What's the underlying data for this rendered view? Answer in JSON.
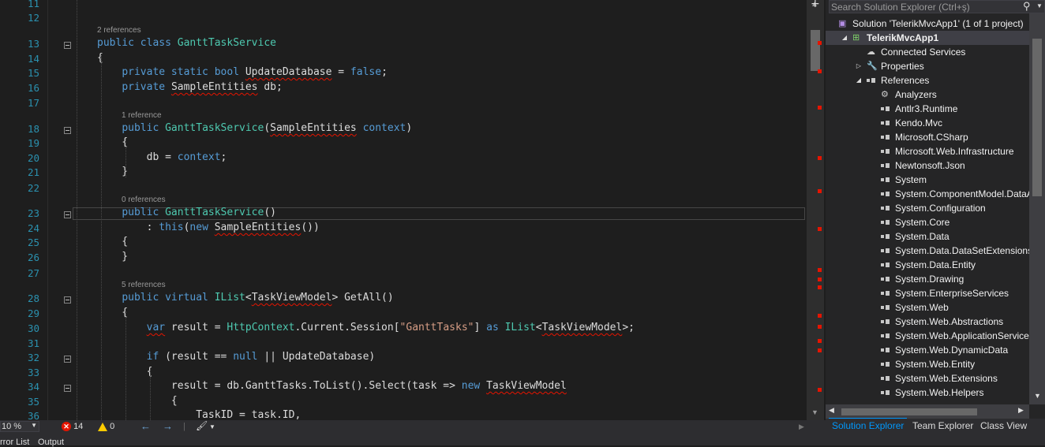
{
  "editor": {
    "lines": [
      {
        "num": "11",
        "segments": [
          {
            "t": ""
          }
        ]
      },
      {
        "num": "12",
        "segments": [
          {
            "t": ""
          }
        ]
      },
      {
        "num": "13",
        "lens": "2 references",
        "fold": true,
        "segments": [
          {
            "t": "public class ",
            "c": "kw"
          },
          {
            "t": "GanttTaskService",
            "c": "ty"
          }
        ]
      },
      {
        "num": "14",
        "segments": [
          {
            "t": "{"
          }
        ]
      },
      {
        "num": "15",
        "segments": [
          {
            "t": "    "
          },
          {
            "t": "private static bool ",
            "c": "kw"
          },
          {
            "t": "UpdateDatabase",
            "w": true
          },
          {
            "t": " = "
          },
          {
            "t": "false",
            "c": "kw"
          },
          {
            "t": ";"
          }
        ]
      },
      {
        "num": "16",
        "segments": [
          {
            "t": "    "
          },
          {
            "t": "private ",
            "c": "kw"
          },
          {
            "t": "SampleEntities",
            "w": true
          },
          {
            "t": " db;"
          }
        ]
      },
      {
        "num": "17",
        "segments": [
          {
            "t": ""
          }
        ]
      },
      {
        "num": "18",
        "lens": "1 reference",
        "fold": true,
        "segments": [
          {
            "t": "    "
          },
          {
            "t": "public ",
            "c": "kw"
          },
          {
            "t": "GanttTaskService",
            "c": "ty"
          },
          {
            "t": "("
          },
          {
            "t": "SampleEntities",
            "w": true
          },
          {
            "t": " "
          },
          {
            "t": "context",
            "c": "kw"
          },
          {
            "t": ")"
          }
        ]
      },
      {
        "num": "19",
        "segments": [
          {
            "t": "    {"
          }
        ]
      },
      {
        "num": "20",
        "segments": [
          {
            "t": "        db = "
          },
          {
            "t": "context",
            "c": "kw"
          },
          {
            "t": ";"
          }
        ]
      },
      {
        "num": "21",
        "segments": [
          {
            "t": "    }"
          }
        ]
      },
      {
        "num": "22",
        "segments": [
          {
            "t": ""
          }
        ]
      },
      {
        "num": "23",
        "lens": "0 references",
        "fold": true,
        "segments": [
          {
            "t": "    "
          },
          {
            "t": "public ",
            "c": "kw"
          },
          {
            "t": "GanttTaskService",
            "c": "ty"
          },
          {
            "t": "()"
          }
        ]
      },
      {
        "num": "24",
        "segments": [
          {
            "t": "        : "
          },
          {
            "t": "this",
            "c": "kw"
          },
          {
            "t": "("
          },
          {
            "t": "new ",
            "c": "kw"
          },
          {
            "t": "SampleEntities",
            "w": true
          },
          {
            "t": "())"
          }
        ]
      },
      {
        "num": "25",
        "segments": [
          {
            "t": "    {"
          }
        ]
      },
      {
        "num": "26",
        "segments": [
          {
            "t": "    }"
          }
        ]
      },
      {
        "num": "27",
        "segments": [
          {
            "t": ""
          }
        ]
      },
      {
        "num": "28",
        "lens": "5 references",
        "fold": true,
        "segments": [
          {
            "t": "    "
          },
          {
            "t": "public virtual ",
            "c": "kw"
          },
          {
            "t": "IList",
            "c": "ty"
          },
          {
            "t": "<"
          },
          {
            "t": "TaskViewModel",
            "w": true
          },
          {
            "t": "> GetAll()"
          }
        ]
      },
      {
        "num": "29",
        "segments": [
          {
            "t": "    {"
          }
        ]
      },
      {
        "num": "30",
        "segments": [
          {
            "t": "        "
          },
          {
            "t": "var",
            "c": "kw",
            "w": true
          },
          {
            "t": " result = "
          },
          {
            "t": "HttpContext",
            "c": "ty"
          },
          {
            "t": ".Current.Session["
          },
          {
            "t": "\"GanttTasks\"",
            "c": "st"
          },
          {
            "t": "] "
          },
          {
            "t": "as ",
            "c": "kw"
          },
          {
            "t": "IList",
            "c": "ty"
          },
          {
            "t": "<"
          },
          {
            "t": "TaskViewModel",
            "w": true
          },
          {
            "t": ">;"
          }
        ]
      },
      {
        "num": "31",
        "segments": [
          {
            "t": ""
          }
        ]
      },
      {
        "num": "32",
        "fold": true,
        "segments": [
          {
            "t": "        "
          },
          {
            "t": "if",
            "c": "kw"
          },
          {
            "t": " (result == "
          },
          {
            "t": "null",
            "c": "kw"
          },
          {
            "t": " || UpdateDatabase)"
          }
        ]
      },
      {
        "num": "33",
        "segments": [
          {
            "t": "        {"
          }
        ]
      },
      {
        "num": "34",
        "fold": true,
        "segments": [
          {
            "t": "            result = db.GanttTasks.ToList().Select(task => "
          },
          {
            "t": "new ",
            "c": "kw"
          },
          {
            "t": "TaskViewModel",
            "w": true
          }
        ]
      },
      {
        "num": "35",
        "segments": [
          {
            "t": "            {"
          }
        ]
      },
      {
        "num": "36",
        "segments": [
          {
            "t": "                TaskID = task.ID,"
          }
        ]
      }
    ]
  },
  "status": {
    "zoom": "10 %",
    "errors": "14",
    "warnings": "0"
  },
  "bottom_tabs": {
    "error_list": "rror List",
    "output": "Output"
  },
  "solution_explorer": {
    "search_placeholder": "Search Solution Explorer (Ctrl+ş)",
    "items": [
      {
        "label": "Solution 'TelerikMvcApp1' (1 of 1 project)",
        "icon": "solution-icon",
        "indent": 0
      },
      {
        "label": "TelerikMvcApp1",
        "icon": "web-project-icon",
        "indent": 1,
        "expanded": true,
        "selected": true
      },
      {
        "label": "Connected Services",
        "icon": "cloud-icon",
        "indent": 2
      },
      {
        "label": "Properties",
        "icon": "wrench-icon",
        "indent": 2,
        "collapsed": true
      },
      {
        "label": "References",
        "icon": "reference-icon",
        "indent": 2,
        "expanded": true
      },
      {
        "label": "Analyzers",
        "icon": "analyzer-icon",
        "indent": 3
      },
      {
        "label": "Antlr3.Runtime",
        "icon": "reference-icon",
        "indent": 3
      },
      {
        "label": "Kendo.Mvc",
        "icon": "reference-icon",
        "indent": 3
      },
      {
        "label": "Microsoft.CSharp",
        "icon": "reference-icon",
        "indent": 3
      },
      {
        "label": "Microsoft.Web.Infrastructure",
        "icon": "reference-icon",
        "indent": 3
      },
      {
        "label": "Newtonsoft.Json",
        "icon": "reference-icon",
        "indent": 3
      },
      {
        "label": "System",
        "icon": "reference-icon",
        "indent": 3
      },
      {
        "label": "System.ComponentModel.DataAnnotations",
        "icon": "reference-icon",
        "indent": 3
      },
      {
        "label": "System.Configuration",
        "icon": "reference-icon",
        "indent": 3
      },
      {
        "label": "System.Core",
        "icon": "reference-icon",
        "indent": 3
      },
      {
        "label": "System.Data",
        "icon": "reference-icon",
        "indent": 3
      },
      {
        "label": "System.Data.DataSetExtensions",
        "icon": "reference-icon",
        "indent": 3
      },
      {
        "label": "System.Data.Entity",
        "icon": "reference-icon",
        "indent": 3
      },
      {
        "label": "System.Drawing",
        "icon": "reference-icon",
        "indent": 3
      },
      {
        "label": "System.EnterpriseServices",
        "icon": "reference-icon",
        "indent": 3
      },
      {
        "label": "System.Web",
        "icon": "reference-icon",
        "indent": 3
      },
      {
        "label": "System.Web.Abstractions",
        "icon": "reference-icon",
        "indent": 3
      },
      {
        "label": "System.Web.ApplicationServices",
        "icon": "reference-icon",
        "indent": 3
      },
      {
        "label": "System.Web.DynamicData",
        "icon": "reference-icon",
        "indent": 3
      },
      {
        "label": "System.Web.Entity",
        "icon": "reference-icon",
        "indent": 3
      },
      {
        "label": "System.Web.Extensions",
        "icon": "reference-icon",
        "indent": 3
      },
      {
        "label": "System.Web.Helpers",
        "icon": "reference-icon",
        "indent": 3
      }
    ],
    "tabs": [
      "Solution Explorer",
      "Team Explorer",
      "Class View"
    ]
  },
  "colors": {
    "keyword": "#569cd6",
    "type": "#4ec9b0",
    "string": "#d69d85",
    "error": "#e51400",
    "accent": "#0097fb"
  }
}
